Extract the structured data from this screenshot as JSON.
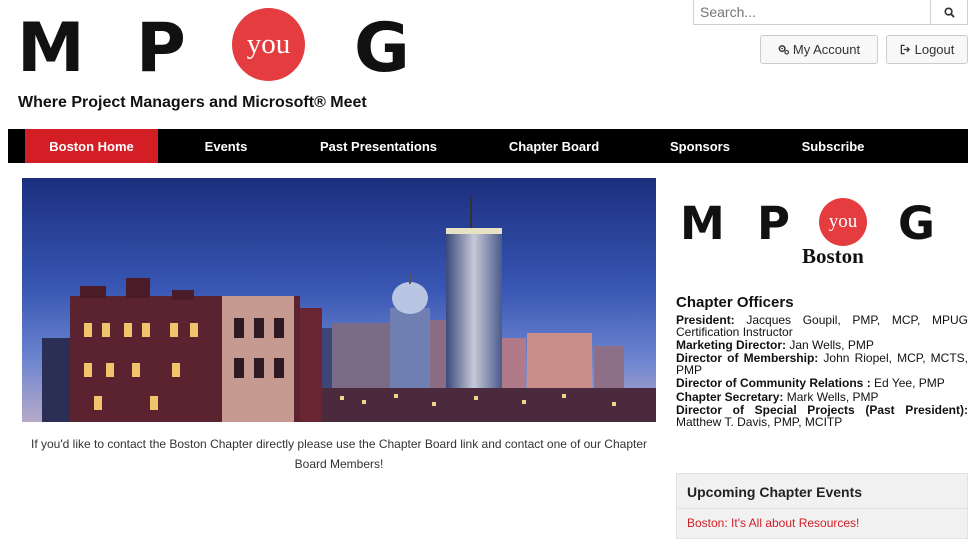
{
  "header": {
    "logo": {
      "letters": [
        "M",
        "P",
        "G"
      ],
      "circle_text": "you"
    },
    "tagline": "Where Project Managers and Microsoft® Meet"
  },
  "search": {
    "placeholder": "Search..."
  },
  "account": {
    "my_account_label": "My Account",
    "logout_label": "Logout"
  },
  "nav": {
    "items": [
      {
        "label": "Boston Home",
        "active": true
      },
      {
        "label": "Events"
      },
      {
        "label": "Past Presentations"
      },
      {
        "label": "Chapter Board"
      },
      {
        "label": "Sponsors"
      },
      {
        "label": "Subscribe"
      }
    ]
  },
  "main": {
    "contact_text": "If you'd like to contact the Boston Chapter directly please use the Chapter Board link and contact one of our Chapter Board Members!"
  },
  "sidebar": {
    "logo": {
      "letters": [
        "M",
        "P",
        "G"
      ],
      "circle_text": "you",
      "city": "Boston"
    },
    "officers_heading": "Chapter Officers",
    "officers": [
      {
        "role": "President:",
        "name": " Jacques Goupil, PMP, MCP, MPUG Certification Instructor"
      },
      {
        "role": "Marketing Director:",
        "name": " Jan Wells, PMP"
      },
      {
        "role": "Director of Membership:",
        "name": " John Riopel, MCP, MCTS, PMP"
      },
      {
        "role": "Director of Community Relations :",
        "name": " Ed Yee, PMP"
      },
      {
        "role": "Chapter Secretary:",
        "name": " Mark Wells, PMP"
      },
      {
        "role": "Director of Special Projects (Past President):",
        "name": " Matthew T. Davis, PMP, MCITP"
      }
    ],
    "events_heading": "Upcoming Chapter Events",
    "events": [
      {
        "label": "Boston: It's All about Resources!"
      }
    ]
  },
  "colors": {
    "brand_red": "#d21e24",
    "nav_bg": "#000000",
    "text": "#111111"
  }
}
